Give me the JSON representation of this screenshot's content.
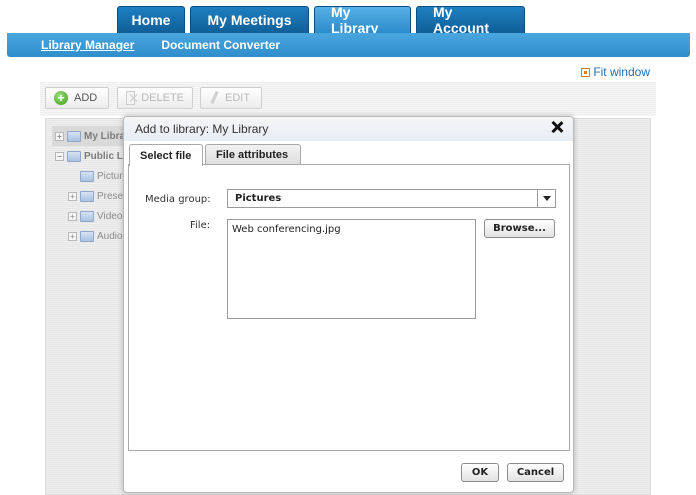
{
  "nav": {
    "tabs": [
      {
        "label": "Home"
      },
      {
        "label": "My Meetings"
      },
      {
        "label": "My Library"
      },
      {
        "label": "My Account"
      }
    ]
  },
  "subnav": {
    "library_manager": "Library Manager",
    "document_converter": "Document Converter"
  },
  "fit_window": "Fit window",
  "toolbar": {
    "add": "ADD",
    "delete": "DELETE",
    "edit": "EDIT"
  },
  "tree": {
    "items": [
      {
        "label": "My Library"
      },
      {
        "label": "Public Library"
      },
      {
        "label": "Pictures"
      },
      {
        "label": "Presentations"
      },
      {
        "label": "Videos"
      },
      {
        "label": "Audio"
      }
    ]
  },
  "dialog": {
    "title": "Add to library: My Library",
    "tabs": [
      {
        "label": "Select file"
      },
      {
        "label": "File attributes"
      }
    ],
    "media_group_label": "Media group:",
    "media_group_value": "Pictures",
    "file_label": "File:",
    "file_value": "Web conferencing.jpg",
    "browse_label": "Browse...",
    "ok_label": "OK",
    "cancel_label": "Cancel"
  },
  "colors": {
    "nav_tab": "#1570b0",
    "nav_tab_active": "#3d9ad6",
    "subnav": "#3a98d6",
    "link": "#1c6fb5"
  }
}
